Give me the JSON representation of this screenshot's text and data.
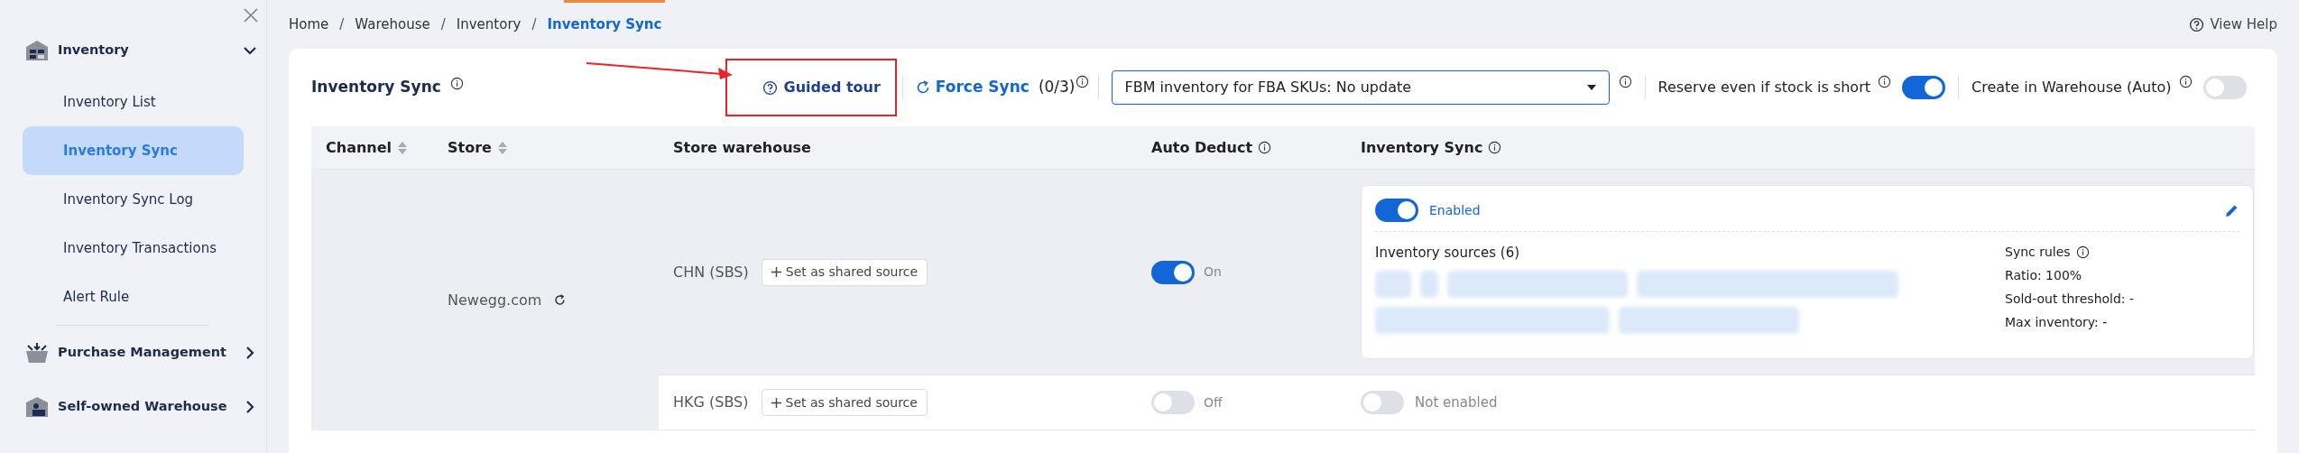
{
  "sidebar": {
    "groups": [
      {
        "label": "Inventory",
        "expanded": true,
        "children": [
          {
            "label": "Inventory List",
            "selected": false
          },
          {
            "label": "Inventory Sync",
            "selected": true
          },
          {
            "label": "Inventory Sync Log",
            "selected": false
          },
          {
            "label": "Inventory Transactions",
            "selected": false
          },
          {
            "label": "Alert Rule",
            "selected": false
          }
        ]
      },
      {
        "label": "Purchase Management",
        "expanded": false
      },
      {
        "label": "Self-owned Warehouse",
        "expanded": false
      }
    ]
  },
  "breadcrumb": [
    {
      "label": "Home",
      "current": false
    },
    {
      "separator": "/",
      "label": "Warehouse",
      "current": false
    },
    {
      "separator": "/",
      "label": "Inventory",
      "current": false
    },
    {
      "separator": "/",
      "label": "Inventory Sync",
      "current": true
    }
  ],
  "help": "View Help",
  "toolbar": {
    "title": "Inventory Sync",
    "guided_tour": "Guided tour",
    "force_sync": {
      "label": "Force Sync",
      "count": "(0/3)"
    },
    "select": "FBM inventory for FBA SKUs: No update",
    "toggles": [
      {
        "label": "Reserve even if stock is short",
        "on": true
      },
      {
        "label": "Create in Warehouse (Auto)",
        "on": false
      }
    ]
  },
  "table": {
    "columns": [
      {
        "label": "Channel",
        "sortable": true,
        "info": false
      },
      {
        "label": "Store",
        "sortable": true,
        "info": false
      },
      {
        "label": "Store warehouse",
        "sortable": false,
        "info": false
      },
      {
        "label": "Auto Deduct",
        "sortable": false,
        "info": true
      },
      {
        "label": "Inventory Sync",
        "sortable": false,
        "info": true
      }
    ],
    "store": {
      "name": "Newegg.com",
      "warehouses": [
        {
          "name": "CHN (SBS)",
          "button": "Set as shared source",
          "highlighted": true,
          "auto_deduct": {
            "on": true,
            "label": "On"
          },
          "sync": {
            "on": true,
            "label": "Enabled",
            "sources_label": "Inventory sources (6)",
            "rules_title": "Sync rules",
            "rules": [
              "Ratio: 100%",
              "Sold-out threshold: -",
              "Max inventory: -"
            ]
          }
        },
        {
          "name": "HKG (SBS)",
          "button": "Set as shared source",
          "highlighted": false,
          "auto_deduct": {
            "on": false,
            "label": "Off"
          },
          "sync": {
            "on": false,
            "label": "Not enabled"
          }
        }
      ]
    }
  }
}
